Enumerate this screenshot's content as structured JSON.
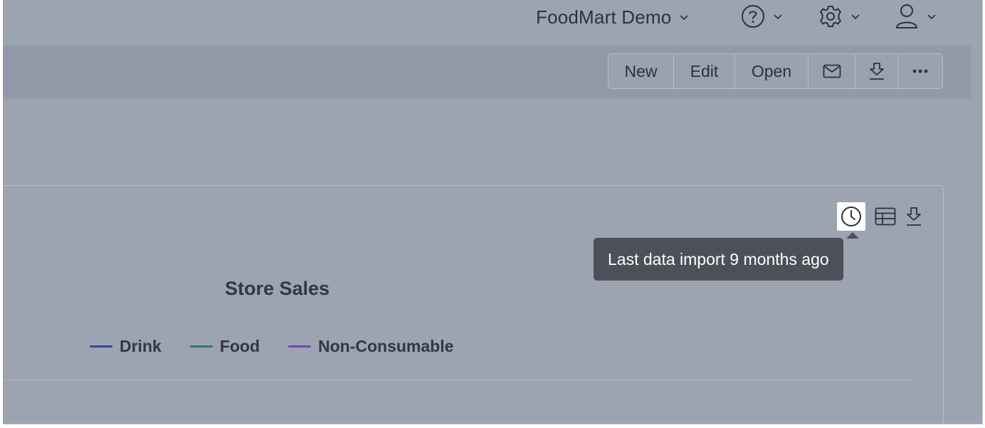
{
  "header": {
    "app_title": "FoodMart Demo",
    "help_icon": "help-circle-icon",
    "settings_icon": "gear-icon",
    "user_icon": "user-icon"
  },
  "toolbar": {
    "buttons": [
      {
        "label": "New"
      },
      {
        "label": "Edit"
      },
      {
        "label": "Open"
      },
      {
        "icon": "mail-icon"
      },
      {
        "icon": "download-icon"
      },
      {
        "icon": "more-icon"
      }
    ]
  },
  "card": {
    "icons": [
      "clock-icon",
      "table-icon",
      "download-icon"
    ],
    "tooltip": "Last data import 9 months ago"
  },
  "chart_data": {
    "type": "line",
    "title": "Store Sales",
    "series": [
      {
        "name": "Drink",
        "color": "#2d4f8f"
      },
      {
        "name": "Food",
        "color": "#2e7b63"
      },
      {
        "name": "Non-Consumable",
        "color": "#7646a8"
      }
    ]
  }
}
